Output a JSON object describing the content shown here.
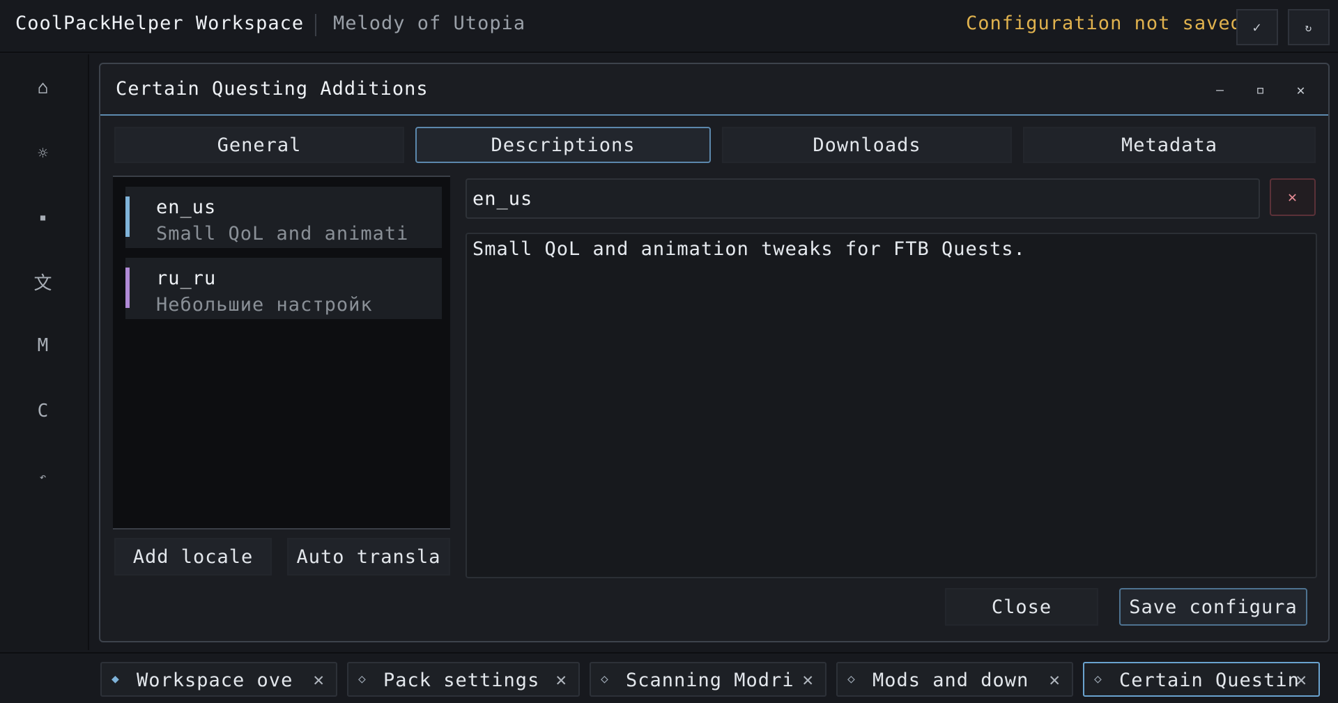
{
  "topbar": {
    "app_title": "CoolPackHelper Workspace",
    "workspace_name": "Melody of Utopia",
    "status": "Configuration not saved",
    "confirm_icon": "✓",
    "refresh_icon": "↻"
  },
  "sidebar": {
    "items": [
      {
        "icon": "⌂",
        "name": "home-icon"
      },
      {
        "icon": "☼",
        "name": "settings-icon"
      },
      {
        "icon": "■",
        "name": "mods-icon"
      },
      {
        "icon": "文",
        "name": "translate-icon"
      },
      {
        "icon": "M",
        "name": "modrinth-icon"
      },
      {
        "icon": "C",
        "name": "curseforge-icon"
      },
      {
        "icon": "↶",
        "name": "back-icon"
      }
    ]
  },
  "dialog": {
    "title": "Certain Questing Additions",
    "minimize": "—",
    "maximize": "▫",
    "close": "✕",
    "tabs": [
      "General",
      "Descriptions",
      "Downloads",
      "Metadata"
    ],
    "active_tab": "Descriptions",
    "locales": [
      {
        "code": "en_us",
        "desc": "Small QoL and animati",
        "color": "#7fb3d9"
      },
      {
        "code": "ru_ru",
        "desc": "Небольшие настройк",
        "color": "#b08ad6"
      }
    ],
    "add_locale": "Add locale",
    "auto_translate": "Auto transla",
    "locale_field": "en_us",
    "remove_icon": "✕",
    "description": "Small QoL and animation tweaks for FTB Quests.",
    "close_button": "Close",
    "save_button": "Save configura"
  },
  "bottom_tabs": [
    {
      "label": "Workspace ove",
      "icon": "◆",
      "active": false
    },
    {
      "label": "Pack settings",
      "icon": "◇",
      "active": false
    },
    {
      "label": "Scanning Modri",
      "icon": "◇",
      "active": false
    },
    {
      "label": "Mods and down",
      "icon": "◇",
      "active": false
    },
    {
      "label": "Certain Questin",
      "icon": "◇",
      "active": true
    }
  ],
  "bottom_close_icon": "✕",
  "colors": {
    "accent": "#5c88ad",
    "warning": "#e0b24e",
    "danger": "#e58b95"
  }
}
